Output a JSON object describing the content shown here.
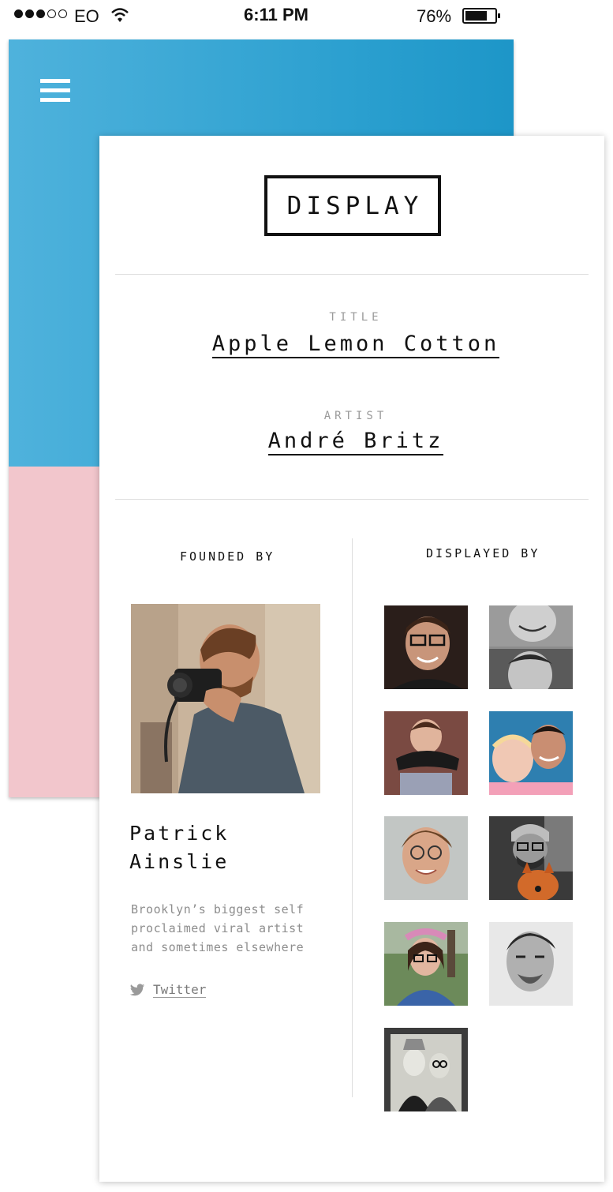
{
  "status_bar": {
    "carrier": "EO",
    "time": "6:11 PM",
    "battery": "76%",
    "battery_level": 0.76,
    "signal_bars": 3
  },
  "app": {
    "logo": "DISPLAY",
    "menu_icon": "hamburger-menu-icon"
  },
  "colors": {
    "accent_blue": "#2a9fcf",
    "accent_pink": "#f2c6cc"
  },
  "artwork": {
    "title_label": "TITLE",
    "title": "Apple Lemon Cotton",
    "artist_label": "ARTIST",
    "artist": "André Britz"
  },
  "founder": {
    "heading": "FOUNDED BY",
    "name": "Patrick Ainslie",
    "bio": "Brooklyn’s biggest self proclaimed viral artist and sometimes elsewhere",
    "link_label": "Twitter",
    "link_icon": "twitter-bird-icon"
  },
  "displayed_by": {
    "heading": "DISPLAYED BY",
    "count": 9
  }
}
